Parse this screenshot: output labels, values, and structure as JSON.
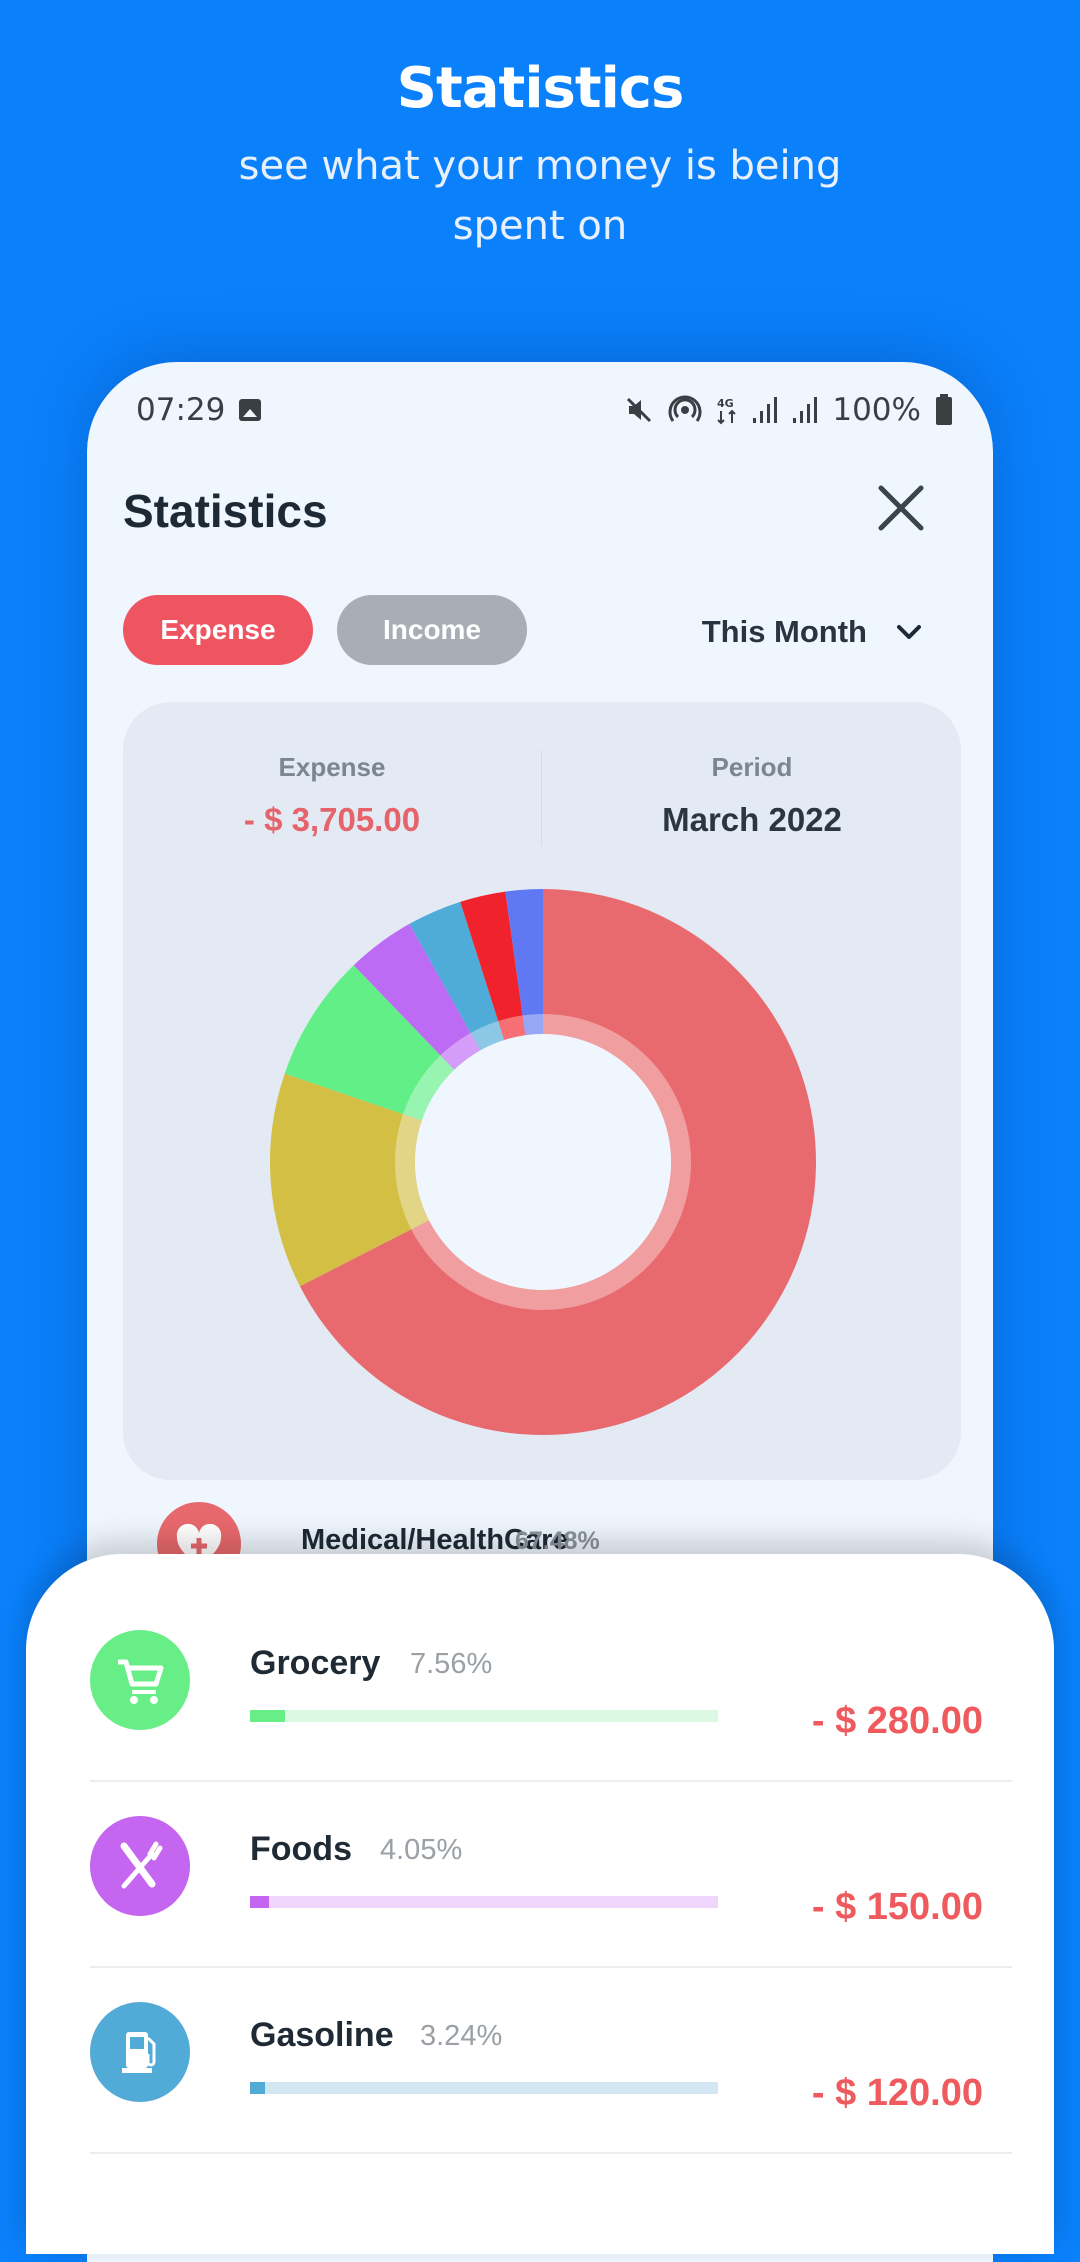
{
  "hero": {
    "title": "Statistics",
    "subtitle": "see what your money is being spent on"
  },
  "status_bar": {
    "time": "07:29",
    "battery": "100%",
    "network": "4G",
    "icons": [
      "image-notification-icon",
      "mute-icon",
      "hotspot-icon",
      "4g-data-icon",
      "signal-icon",
      "signal-icon",
      "battery-icon"
    ]
  },
  "header": {
    "title": "Statistics",
    "close_icon": "close-icon"
  },
  "tabs": [
    {
      "label": "Expense",
      "active": true,
      "color": "#ef5560"
    },
    {
      "label": "Income",
      "active": false,
      "color": "#a8aeb6"
    }
  ],
  "period_select": {
    "value": "This Month",
    "icon": "chevron-down-icon"
  },
  "summary": {
    "expense_label": "Expense",
    "expense_value": "- $ 3,705.00",
    "period_label": "Period",
    "period_value": "March 2022"
  },
  "chart_data": {
    "type": "pie",
    "variant": "donut",
    "title": "",
    "start": "top",
    "slices": [
      {
        "label": "Medical/HealthCare",
        "percent": 67.48,
        "color": "#e86a6e"
      },
      {
        "label": "Unlabeled (yellow)",
        "percent": 12.77,
        "color": "#d4bf45"
      },
      {
        "label": "Grocery",
        "percent": 7.56,
        "color": "#62ef88"
      },
      {
        "label": "Foods",
        "percent": 4.05,
        "color": "#bd6af4"
      },
      {
        "label": "Gasoline",
        "percent": 3.24,
        "color": "#4fabd8"
      },
      {
        "label": "Unlabeled (red)",
        "percent": 2.7,
        "color": "#f0222c"
      },
      {
        "label": "Unlabeled (blue)",
        "percent": 2.2,
        "color": "#6079f3"
      }
    ]
  },
  "categories": [
    {
      "name": "Medical/HealthCare",
      "percent": "67.48%",
      "icon": "medical-heart-icon",
      "color": "#e8696d"
    },
    {
      "name": "Grocery",
      "percent": "7.56%",
      "fraction": 0.0756,
      "amount": "- $ 280.00",
      "icon": "shopping-cart-icon",
      "color": "#67ee87",
      "track": "#dbf9e3"
    },
    {
      "name": "Foods",
      "percent": "4.05%",
      "fraction": 0.0405,
      "amount": "- $ 150.00",
      "icon": "knife-fork-icon",
      "color": "#c466ef",
      "track": "#efd6fa"
    },
    {
      "name": "Gasoline",
      "percent": "3.24%",
      "fraction": 0.0324,
      "amount": "- $ 120.00",
      "icon": "gas-pump-icon",
      "color": "#52abd6",
      "track": "#d2e7f2"
    }
  ]
}
